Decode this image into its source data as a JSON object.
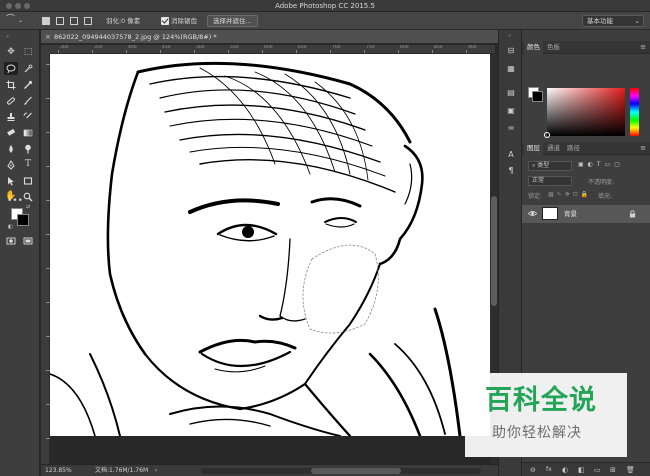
{
  "window": {
    "title": "Adobe Photoshop CC 2015.5"
  },
  "options_bar": {
    "feather_label": "羽化:",
    "feather_value": "0 像素",
    "antialias_label": "消除锯齿",
    "antialias_checked": true,
    "select_mask_button": "选择并遮住...",
    "workspace": "基本功能"
  },
  "document": {
    "tab_label": "862022_094944037578_2.jpg @ 124%(RGB/8#) *",
    "tab_close": "×",
    "ruler_marks": [
      "300",
      "350",
      "400",
      "450",
      "500",
      "550",
      "600",
      "650",
      "700",
      "750",
      "800",
      "850",
      "900"
    ]
  },
  "status_bar": {
    "zoom": "123.85%",
    "doc_info": "文档:1.76M/1.76M",
    "arrow": "›"
  },
  "panels": {
    "color_tabs": [
      "颜色",
      "色板"
    ],
    "layer_tabs": [
      "图层",
      "通道",
      "路径"
    ],
    "panel_menu": "≡",
    "kind_filter": "类型",
    "blend_mode": "正常",
    "opacity_label": "不透明度:",
    "lock_label": "锁定:",
    "fill_label": "填充:",
    "layer_name": "背景",
    "footer_icons": [
      "⊖",
      "fx",
      "◐",
      "◧",
      "▭",
      "⊞",
      "🗑"
    ]
  },
  "watermark": {
    "title": "百科全说",
    "subtitle": "助你轻松解决"
  },
  "colors": {
    "foreground": "#ffffff",
    "background": "#000000",
    "watermark_green": "#23a456"
  }
}
